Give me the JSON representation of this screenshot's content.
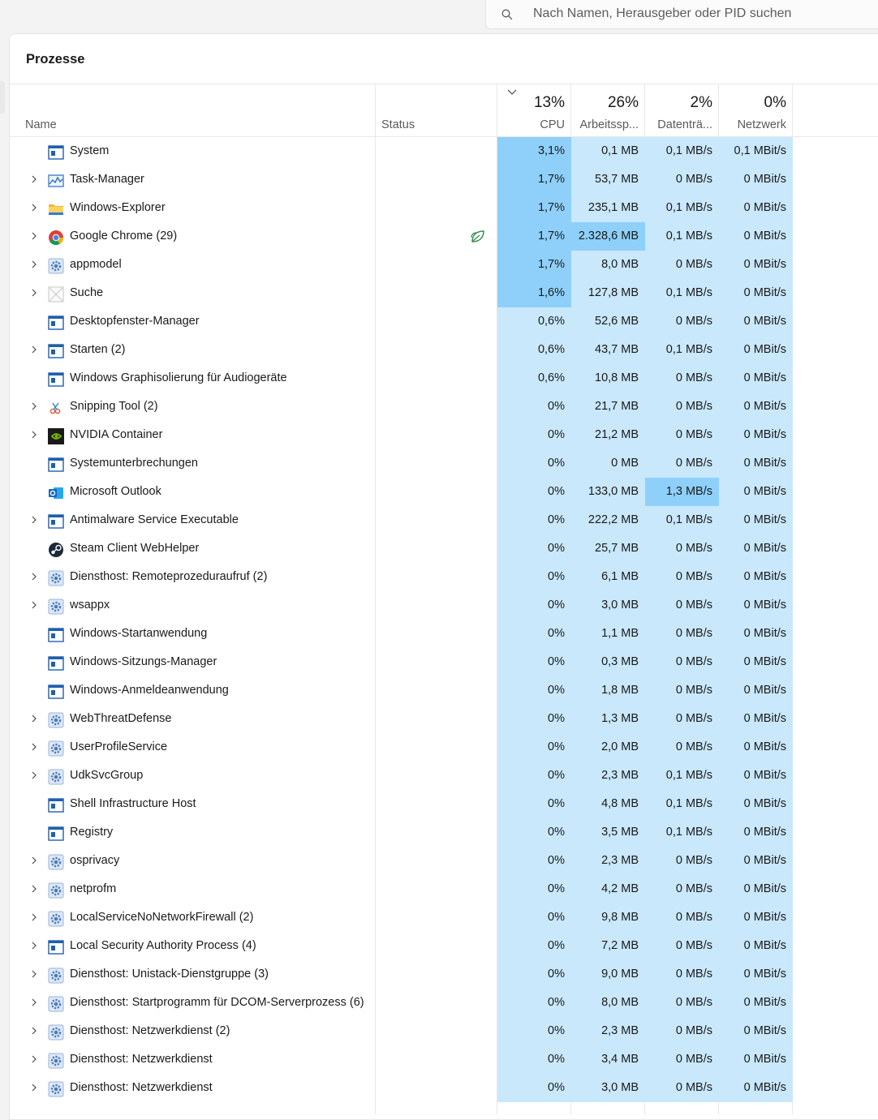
{
  "search": {
    "placeholder": "Nach Namen, Herausgeber oder PID suchen"
  },
  "panel": {
    "title": "Prozesse"
  },
  "columns": {
    "name": "Name",
    "status": "Status",
    "cpu": {
      "pct": "13%",
      "label": "CPU"
    },
    "memory": {
      "pct": "26%",
      "label": "Arbeitssp..."
    },
    "disk": {
      "pct": "2%",
      "label": "Datenträ..."
    },
    "network": {
      "pct": "0%",
      "label": "Netzwerk"
    }
  },
  "colors": {
    "heat_low": "#c9e8fb",
    "heat_mid": "#b7e0fa",
    "heat_high": "#8ed0fa",
    "eco_leaf": "#2f8a4a"
  },
  "processes": [
    {
      "name": "System",
      "icon": "window-icon",
      "expandable": false,
      "eco": false,
      "cpu": "3,1%",
      "mem": "0,1 MB",
      "disk": "0,1 MB/s",
      "net": "0,1 MBit/s",
      "heat": [
        2,
        1,
        1,
        1
      ]
    },
    {
      "name": "Task-Manager",
      "icon": "task-manager-icon",
      "expandable": true,
      "eco": false,
      "cpu": "1,7%",
      "mem": "53,7 MB",
      "disk": "0 MB/s",
      "net": "0 MBit/s",
      "heat": [
        2,
        1,
        1,
        1
      ]
    },
    {
      "name": "Windows-Explorer",
      "icon": "folder-icon",
      "expandable": true,
      "eco": false,
      "cpu": "1,7%",
      "mem": "235,1 MB",
      "disk": "0,1 MB/s",
      "net": "0 MBit/s",
      "heat": [
        2,
        1,
        1,
        1
      ]
    },
    {
      "name": "Google Chrome (29)",
      "icon": "chrome-icon",
      "expandable": true,
      "eco": true,
      "cpu": "1,7%",
      "mem": "2.328,6 MB",
      "disk": "0,1 MB/s",
      "net": "0 MBit/s",
      "heat": [
        2,
        2,
        1,
        1
      ]
    },
    {
      "name": "appmodel",
      "icon": "service-gear-icon",
      "expandable": true,
      "eco": false,
      "cpu": "1,7%",
      "mem": "8,0 MB",
      "disk": "0 MB/s",
      "net": "0 MBit/s",
      "heat": [
        2,
        1,
        1,
        1
      ]
    },
    {
      "name": "Suche",
      "icon": "search-app-icon",
      "expandable": true,
      "eco": false,
      "cpu": "1,6%",
      "mem": "127,8 MB",
      "disk": "0,1 MB/s",
      "net": "0 MBit/s",
      "heat": [
        2,
        1,
        1,
        1
      ]
    },
    {
      "name": "Desktopfenster-Manager",
      "icon": "window-icon",
      "expandable": false,
      "eco": false,
      "cpu": "0,6%",
      "mem": "52,6 MB",
      "disk": "0 MB/s",
      "net": "0 MBit/s",
      "heat": [
        1,
        1,
        1,
        1
      ]
    },
    {
      "name": "Starten (2)",
      "icon": "window-icon",
      "expandable": true,
      "eco": false,
      "cpu": "0,6%",
      "mem": "43,7 MB",
      "disk": "0,1 MB/s",
      "net": "0 MBit/s",
      "heat": [
        1,
        1,
        1,
        1
      ]
    },
    {
      "name": "Windows Graphisolierung für Audiogeräte",
      "icon": "window-icon",
      "expandable": false,
      "eco": false,
      "cpu": "0,6%",
      "mem": "10,8 MB",
      "disk": "0 MB/s",
      "net": "0 MBit/s",
      "heat": [
        1,
        1,
        1,
        1
      ]
    },
    {
      "name": "Snipping Tool (2)",
      "icon": "snipping-tool-icon",
      "expandable": true,
      "eco": false,
      "cpu": "0%",
      "mem": "21,7 MB",
      "disk": "0 MB/s",
      "net": "0 MBit/s",
      "heat": [
        1,
        1,
        1,
        1
      ]
    },
    {
      "name": "NVIDIA Container",
      "icon": "nvidia-icon",
      "expandable": true,
      "eco": false,
      "cpu": "0%",
      "mem": "21,2 MB",
      "disk": "0 MB/s",
      "net": "0 MBit/s",
      "heat": [
        1,
        1,
        1,
        1
      ]
    },
    {
      "name": "Systemunterbrechungen",
      "icon": "window-icon",
      "expandable": false,
      "eco": false,
      "cpu": "0%",
      "mem": "0 MB",
      "disk": "0 MB/s",
      "net": "0 MBit/s",
      "heat": [
        1,
        1,
        1,
        1
      ]
    },
    {
      "name": "Microsoft Outlook",
      "icon": "outlook-icon",
      "expandable": false,
      "eco": false,
      "cpu": "0%",
      "mem": "133,0 MB",
      "disk": "1,3 MB/s",
      "net": "0 MBit/s",
      "heat": [
        1,
        1,
        2,
        1
      ]
    },
    {
      "name": "Antimalware Service Executable",
      "icon": "window-icon",
      "expandable": true,
      "eco": false,
      "cpu": "0%",
      "mem": "222,2 MB",
      "disk": "0,1 MB/s",
      "net": "0 MBit/s",
      "heat": [
        1,
        1,
        1,
        1
      ]
    },
    {
      "name": "Steam Client WebHelper",
      "icon": "steam-icon",
      "expandable": false,
      "eco": false,
      "cpu": "0%",
      "mem": "25,7 MB",
      "disk": "0 MB/s",
      "net": "0 MBit/s",
      "heat": [
        1,
        1,
        1,
        1
      ]
    },
    {
      "name": "Diensthost: Remoteprozeduraufruf (2)",
      "icon": "service-gear-icon",
      "expandable": true,
      "eco": false,
      "cpu": "0%",
      "mem": "6,1 MB",
      "disk": "0 MB/s",
      "net": "0 MBit/s",
      "heat": [
        1,
        1,
        1,
        1
      ]
    },
    {
      "name": "wsappx",
      "icon": "service-gear-icon",
      "expandable": true,
      "eco": false,
      "cpu": "0%",
      "mem": "3,0 MB",
      "disk": "0 MB/s",
      "net": "0 MBit/s",
      "heat": [
        1,
        1,
        1,
        1
      ]
    },
    {
      "name": "Windows-Startanwendung",
      "icon": "window-icon",
      "expandable": false,
      "eco": false,
      "cpu": "0%",
      "mem": "1,1 MB",
      "disk": "0 MB/s",
      "net": "0 MBit/s",
      "heat": [
        1,
        1,
        1,
        1
      ]
    },
    {
      "name": "Windows-Sitzungs-Manager",
      "icon": "window-icon",
      "expandable": false,
      "eco": false,
      "cpu": "0%",
      "mem": "0,3 MB",
      "disk": "0 MB/s",
      "net": "0 MBit/s",
      "heat": [
        1,
        1,
        1,
        1
      ]
    },
    {
      "name": "Windows-Anmeldeanwendung",
      "icon": "window-icon",
      "expandable": false,
      "eco": false,
      "cpu": "0%",
      "mem": "1,8 MB",
      "disk": "0 MB/s",
      "net": "0 MBit/s",
      "heat": [
        1,
        1,
        1,
        1
      ]
    },
    {
      "name": "WebThreatDefense",
      "icon": "service-gear-icon",
      "expandable": true,
      "eco": false,
      "cpu": "0%",
      "mem": "1,3 MB",
      "disk": "0 MB/s",
      "net": "0 MBit/s",
      "heat": [
        1,
        1,
        1,
        1
      ]
    },
    {
      "name": "UserProfileService",
      "icon": "service-gear-icon",
      "expandable": true,
      "eco": false,
      "cpu": "0%",
      "mem": "2,0 MB",
      "disk": "0 MB/s",
      "net": "0 MBit/s",
      "heat": [
        1,
        1,
        1,
        1
      ]
    },
    {
      "name": "UdkSvcGroup",
      "icon": "service-gear-icon",
      "expandable": true,
      "eco": false,
      "cpu": "0%",
      "mem": "2,3 MB",
      "disk": "0,1 MB/s",
      "net": "0 MBit/s",
      "heat": [
        1,
        1,
        1,
        1
      ]
    },
    {
      "name": "Shell Infrastructure Host",
      "icon": "window-icon",
      "expandable": false,
      "eco": false,
      "cpu": "0%",
      "mem": "4,8 MB",
      "disk": "0,1 MB/s",
      "net": "0 MBit/s",
      "heat": [
        1,
        1,
        1,
        1
      ]
    },
    {
      "name": "Registry",
      "icon": "window-icon",
      "expandable": false,
      "eco": false,
      "cpu": "0%",
      "mem": "3,5 MB",
      "disk": "0,1 MB/s",
      "net": "0 MBit/s",
      "heat": [
        1,
        1,
        1,
        1
      ]
    },
    {
      "name": "osprivacy",
      "icon": "service-gear-icon",
      "expandable": true,
      "eco": false,
      "cpu": "0%",
      "mem": "2,3 MB",
      "disk": "0 MB/s",
      "net": "0 MBit/s",
      "heat": [
        1,
        1,
        1,
        1
      ]
    },
    {
      "name": "netprofm",
      "icon": "service-gear-icon",
      "expandable": true,
      "eco": false,
      "cpu": "0%",
      "mem": "4,2 MB",
      "disk": "0 MB/s",
      "net": "0 MBit/s",
      "heat": [
        1,
        1,
        1,
        1
      ]
    },
    {
      "name": "LocalServiceNoNetworkFirewall (2)",
      "icon": "service-gear-icon",
      "expandable": true,
      "eco": false,
      "cpu": "0%",
      "mem": "9,8 MB",
      "disk": "0 MB/s",
      "net": "0 MBit/s",
      "heat": [
        1,
        1,
        1,
        1
      ]
    },
    {
      "name": "Local Security Authority Process (4)",
      "icon": "window-icon",
      "expandable": true,
      "eco": false,
      "cpu": "0%",
      "mem": "7,2 MB",
      "disk": "0 MB/s",
      "net": "0 MBit/s",
      "heat": [
        1,
        1,
        1,
        1
      ]
    },
    {
      "name": "Diensthost: Unistack-Dienstgruppe (3)",
      "icon": "service-gear-icon",
      "expandable": true,
      "eco": false,
      "cpu": "0%",
      "mem": "9,0 MB",
      "disk": "0 MB/s",
      "net": "0 MBit/s",
      "heat": [
        1,
        1,
        1,
        1
      ]
    },
    {
      "name": "Diensthost: Startprogramm für DCOM-Serverprozess (6)",
      "icon": "service-gear-icon",
      "expandable": true,
      "eco": false,
      "cpu": "0%",
      "mem": "8,0 MB",
      "disk": "0 MB/s",
      "net": "0 MBit/s",
      "heat": [
        1,
        1,
        1,
        1
      ]
    },
    {
      "name": "Diensthost: Netzwerkdienst (2)",
      "icon": "service-gear-icon",
      "expandable": true,
      "eco": false,
      "cpu": "0%",
      "mem": "2,3 MB",
      "disk": "0 MB/s",
      "net": "0 MBit/s",
      "heat": [
        1,
        1,
        1,
        1
      ]
    },
    {
      "name": "Diensthost: Netzwerkdienst",
      "icon": "service-gear-icon",
      "expandable": true,
      "eco": false,
      "cpu": "0%",
      "mem": "3,4 MB",
      "disk": "0 MB/s",
      "net": "0 MBit/s",
      "heat": [
        1,
        1,
        1,
        1
      ]
    },
    {
      "name": "Diensthost: Netzwerkdienst",
      "icon": "service-gear-icon",
      "expandable": true,
      "eco": false,
      "cpu": "0%",
      "mem": "3,0 MB",
      "disk": "0 MB/s",
      "net": "0 MBit/s",
      "heat": [
        1,
        1,
        1,
        1
      ]
    }
  ]
}
